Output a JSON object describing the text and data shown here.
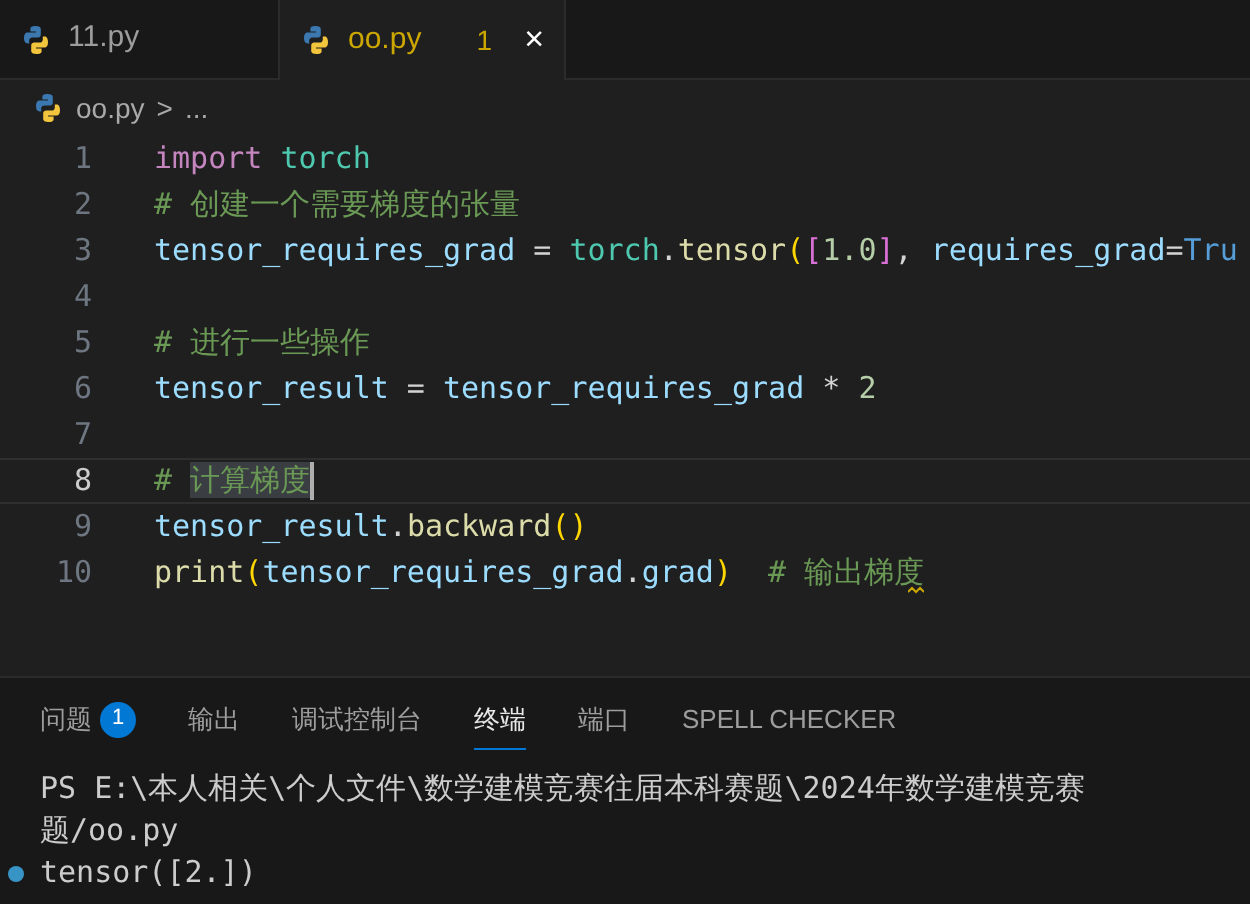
{
  "tabs": [
    {
      "label": "11.py",
      "selected": false,
      "warning": false
    },
    {
      "label": "oo.py",
      "selected": true,
      "warning": true,
      "problems": "1",
      "close": "×"
    }
  ],
  "breadcrumb": {
    "file": "oo.py",
    "separator": ">",
    "rest": "..."
  },
  "code_lines": [
    {
      "number": "1",
      "current": false,
      "tokens": [
        {
          "text": "import ",
          "kind": "keyword"
        },
        {
          "text": "torch",
          "kind": "module"
        }
      ]
    },
    {
      "number": "2",
      "current": false,
      "tokens": [
        {
          "text": "# 创建一个需要梯度的张量",
          "kind": "comment"
        }
      ]
    },
    {
      "number": "3",
      "current": false,
      "tokens": [
        {
          "text": "tensor_requires_grad",
          "kind": "variable"
        },
        {
          "text": " = ",
          "kind": "plain"
        },
        {
          "text": "torch",
          "kind": "module"
        },
        {
          "text": ".",
          "kind": "plain"
        },
        {
          "text": "tensor",
          "kind": "function"
        },
        {
          "text": "(",
          "kind": "bracket"
        },
        {
          "text": "[",
          "kind": "bracket2"
        },
        {
          "text": "1.0",
          "kind": "number"
        },
        {
          "text": "]",
          "kind": "bracket2"
        },
        {
          "text": ", ",
          "kind": "plain"
        },
        {
          "text": "requires_grad",
          "kind": "variable"
        },
        {
          "text": "=",
          "kind": "plain"
        },
        {
          "text": "Tru",
          "kind": "constant"
        }
      ]
    },
    {
      "number": "4",
      "current": false
    },
    {
      "number": "5",
      "current": false,
      "tokens": [
        {
          "text": "# 进行一些操作",
          "kind": "comment"
        }
      ]
    },
    {
      "number": "6",
      "current": false,
      "tokens": [
        {
          "text": "tensor_result",
          "kind": "variable"
        },
        {
          "text": " = ",
          "kind": "plain"
        },
        {
          "text": "tensor_requires_grad",
          "kind": "variable"
        },
        {
          "text": " * ",
          "kind": "plain"
        },
        {
          "text": "2",
          "kind": "number"
        }
      ]
    },
    {
      "number": "7",
      "current": false
    },
    {
      "number": "8",
      "current": true,
      "tokens": [
        {
          "text": "# ",
          "kind": "comment"
        },
        {
          "text": "计算梯度",
          "kind": "comment-selected"
        }
      ]
    },
    {
      "number": "9",
      "current": false,
      "tokens": [
        {
          "text": "tensor_result",
          "kind": "variable"
        },
        {
          "text": ".",
          "kind": "plain"
        },
        {
          "text": "backward",
          "kind": "function"
        },
        {
          "text": "()",
          "kind": "bracket"
        }
      ]
    },
    {
      "number": "10",
      "current": false,
      "squiggle": true,
      "tokens": [
        {
          "text": "print",
          "kind": "function"
        },
        {
          "text": "(",
          "kind": "bracket"
        },
        {
          "text": "tensor_requires_grad",
          "kind": "variable"
        },
        {
          "text": ".",
          "kind": "plain"
        },
        {
          "text": "grad",
          "kind": "variable"
        },
        {
          "text": ")",
          "kind": "bracket"
        },
        {
          "text": "  # 输出梯度",
          "kind": "comment"
        }
      ]
    }
  ],
  "panel_tabs": [
    {
      "label": "问题",
      "selected": false,
      "badge": "1"
    },
    {
      "label": "输出",
      "selected": false
    },
    {
      "label": "调试控制台",
      "selected": false
    },
    {
      "label": "终端",
      "selected": true
    },
    {
      "label": "端口",
      "selected": false
    },
    {
      "label": "SPELL CHECKER",
      "selected": false
    }
  ],
  "terminal_lines": [
    {
      "text": "PS E:\\本人相关\\个人文件\\数学建模竞赛往届本科赛题\\2024年数学建模竞赛",
      "marker": false
    },
    {
      "text": "题/oo.py",
      "marker": false
    },
    {
      "text": "tensor([2.])",
      "marker": true
    }
  ]
}
